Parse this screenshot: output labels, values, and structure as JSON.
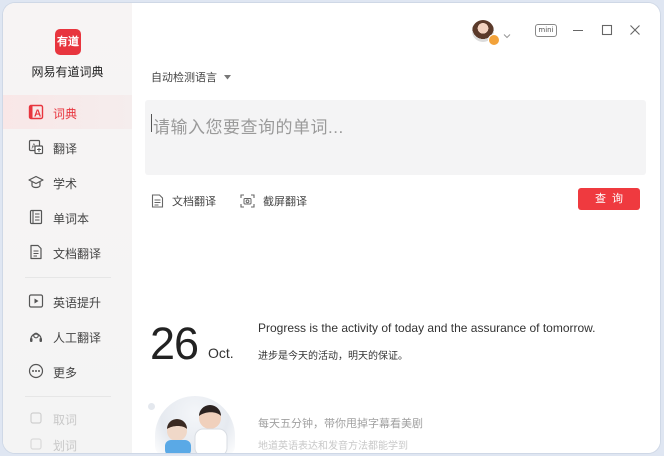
{
  "app": {
    "logo_text": "有道",
    "name": "网易有道词典"
  },
  "sidebar": {
    "items": [
      {
        "label": "词典",
        "icon": "dictionary-icon"
      },
      {
        "label": "翻译",
        "icon": "translate-icon"
      },
      {
        "label": "学术",
        "icon": "academic-cap-icon"
      },
      {
        "label": "单词本",
        "icon": "wordbook-icon"
      },
      {
        "label": "文档翻译",
        "icon": "document-icon"
      },
      {
        "label": "英语提升",
        "icon": "video-play-icon"
      },
      {
        "label": "人工翻译",
        "icon": "human-translation-icon"
      },
      {
        "label": "更多",
        "icon": "more-icon"
      },
      {
        "label": "取词",
        "icon": "checkbox-icon"
      },
      {
        "label": "划词",
        "icon": "checkbox-icon"
      }
    ]
  },
  "titlebar": {
    "mini_label": "mini"
  },
  "search": {
    "language_label": "自动检测语言",
    "placeholder": "请输入您要查询的单词..."
  },
  "tools": {
    "doc_translate": "文档翻译",
    "screenshot_translate": "截屏翻译",
    "query_button": "查询"
  },
  "daily": {
    "day": "26",
    "month": "Oct.",
    "quote_en": "Progress is the activity of today and the assurance of tomorrow.",
    "quote_zh": "进步是今天的活动，明天的保证。"
  },
  "promo": {
    "title": "每天五分钟，带你甩掉字幕看美剧",
    "subtitle": "地道英语表达和发音方法都能学到"
  },
  "colors": {
    "accent": "#ef3a3f",
    "sidebar_bg": "#f5f4f4",
    "active_bg": "#f9e7e7"
  }
}
